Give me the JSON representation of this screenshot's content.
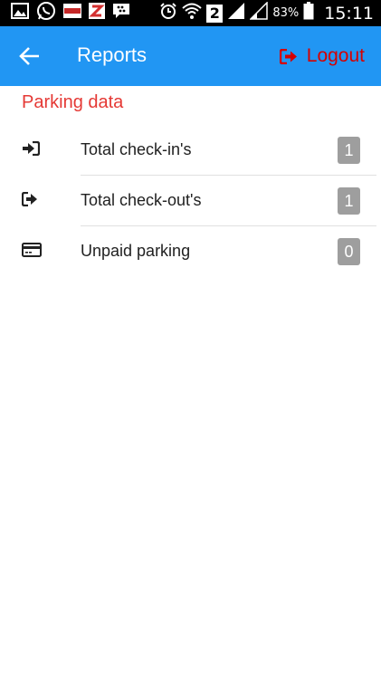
{
  "status_bar": {
    "sim_number": "2",
    "battery_percent": "83%",
    "time": "15:11"
  },
  "app_bar": {
    "title": "Reports",
    "logout_label": "Logout",
    "colors": {
      "bar": "#2196f3",
      "logout": "#d50000"
    }
  },
  "section": {
    "title": "Parking data"
  },
  "reports": [
    {
      "label": "Total check-in's",
      "count": "1",
      "icon": "sign-in-icon"
    },
    {
      "label": "Total check-out's",
      "count": "1",
      "icon": "sign-out-icon"
    },
    {
      "label": "Unpaid parking",
      "count": "0",
      "icon": "credit-card-icon"
    }
  ]
}
